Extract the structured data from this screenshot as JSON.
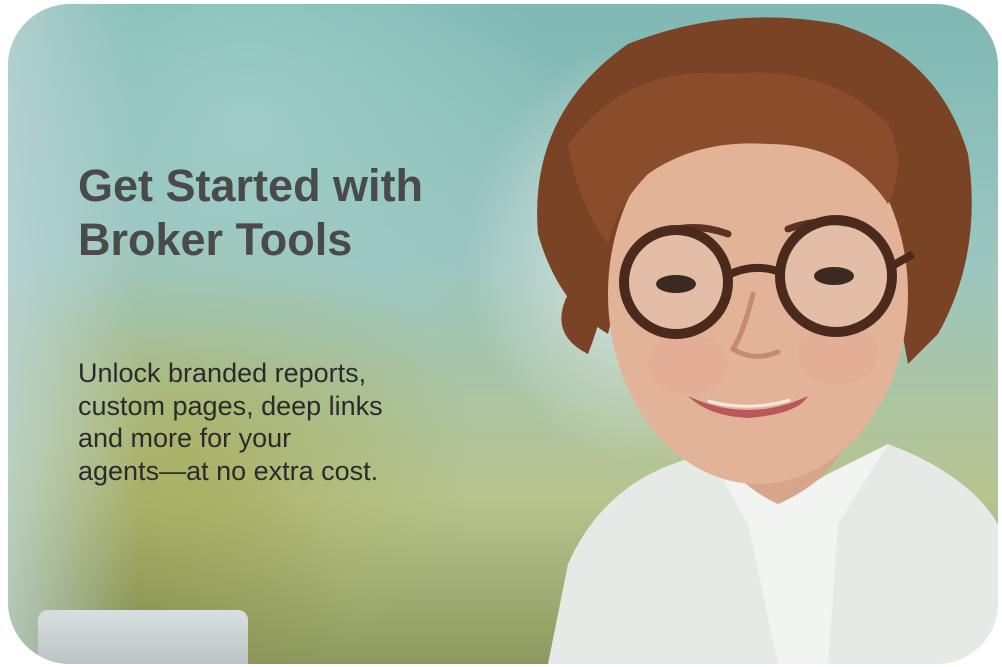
{
  "promo": {
    "title_line1": "Get Started with",
    "title_line2": "Broker Tools",
    "body_lines": [
      "Unlock branded reports,",
      "custom pages, deep links",
      "and more for your",
      "agents—at no extra cost."
    ]
  },
  "image": {
    "subject": "smiling-woman-with-glasses-icon"
  },
  "colors": {
    "title": "#4a4a4a",
    "body": "#2b2b2b",
    "background_teal": "#9cc6bf",
    "background_olive": "#b8c48e"
  }
}
